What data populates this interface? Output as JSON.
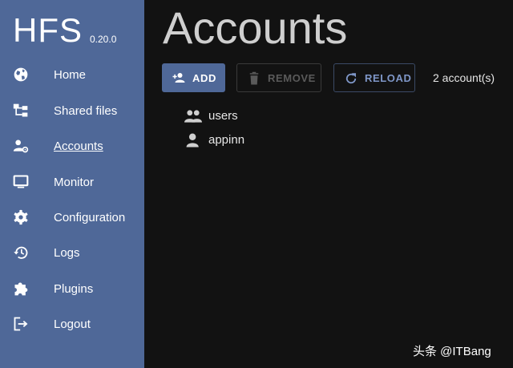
{
  "app": {
    "logo": "HFS",
    "version": "0.20.0"
  },
  "sidebar": {
    "items": [
      {
        "label": "Home",
        "icon": "globe-icon"
      },
      {
        "label": "Shared files",
        "icon": "file-tree-icon"
      },
      {
        "label": "Accounts",
        "icon": "account-settings-icon",
        "active": true
      },
      {
        "label": "Monitor",
        "icon": "monitor-icon"
      },
      {
        "label": "Configuration",
        "icon": "gear-icon"
      },
      {
        "label": "Logs",
        "icon": "history-icon"
      },
      {
        "label": "Plugins",
        "icon": "puzzle-icon"
      },
      {
        "label": "Logout",
        "icon": "logout-icon"
      }
    ]
  },
  "main": {
    "title": "Accounts",
    "toolbar": {
      "add_label": "ADD",
      "remove_label": "REMOVE",
      "reload_label": "RELOAD"
    },
    "count": "2 account(s)",
    "accounts": [
      {
        "name": "users",
        "icon": "group-icon"
      },
      {
        "name": "appinn",
        "icon": "person-icon"
      }
    ]
  },
  "watermark": "头条 @ITBang",
  "colors": {
    "sidebar": "#4f6898",
    "background": "#121212",
    "accent": "#7f97c8"
  }
}
